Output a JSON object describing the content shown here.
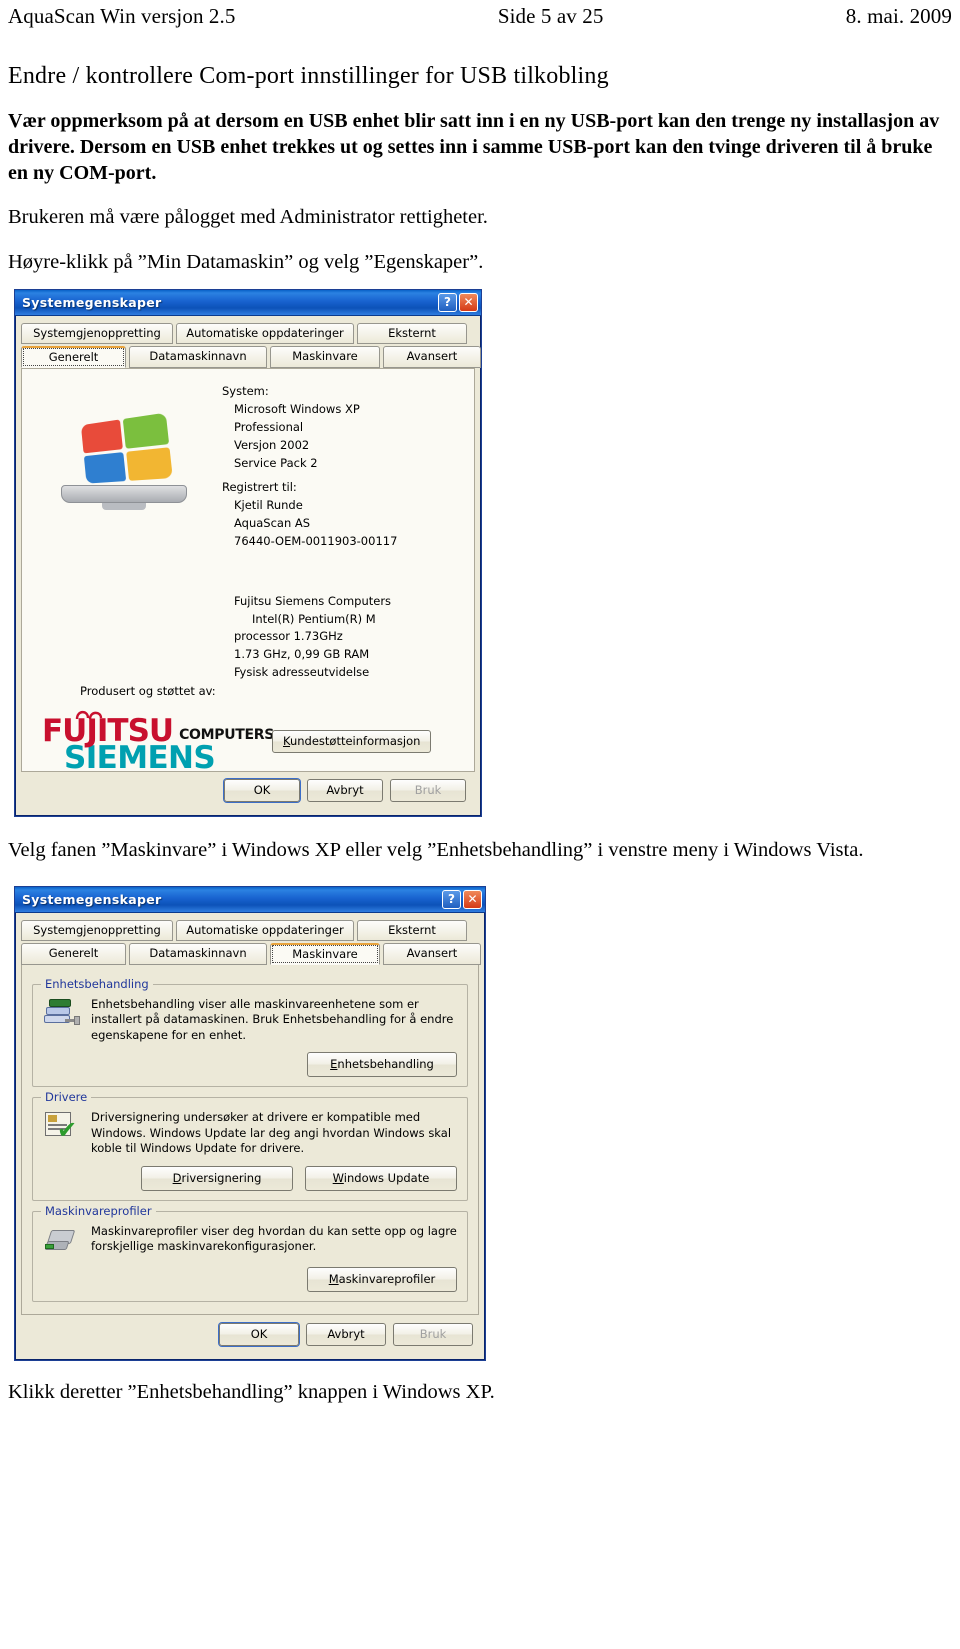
{
  "header": {
    "left": "AquaScan Win versjon 2.5",
    "center": "Side 5 av 25",
    "right": "8. mai. 2009"
  },
  "document": {
    "title": "Endre / kontrollere Com-port innstillinger for USB tilkobling",
    "warning": "Vær oppmerksom på at dersom en USB enhet blir satt inn i en ny USB-port kan den trenge ny installasjon av drivere. Dersom en USB enhet trekkes ut og settes inn i samme USB-port kan den tvinge driveren til å bruke en ny COM-port.",
    "admin_note": "Brukeren må være pålogget med Administrator rettigheter.",
    "step_rightclick": "Høyre-klikk på ”Min Datamaskin” og velg ”Egenskaper”.",
    "step_selecttab": "Velg fanen ”Maskinvare” i Windows XP eller velg ”Enhetsbehandling” i venstre meny i Windows Vista.",
    "step_clickbutton": "Klikk deretter ”Enhetsbehandling” knappen i Windows XP."
  },
  "dialog_general": {
    "title": "Systemegenskaper",
    "help_glyph": "?",
    "close_glyph": "✕",
    "tabs_row1": [
      "Systemgjenoppretting",
      "Automatiske oppdateringer",
      "Eksternt"
    ],
    "tabs_row2": [
      "Generelt",
      "Datamaskinnavn",
      "Maskinvare",
      "Avansert"
    ],
    "selected_tab": "Generelt",
    "system_label": "System:",
    "system_lines": [
      "Microsoft Windows XP",
      "Professional",
      "Versjon 2002",
      "Service Pack 2"
    ],
    "registered_label": "Registrert til:",
    "registered_lines": [
      "Kjetil Runde",
      "AquaScan AS",
      "76440-OEM-0011903-00117"
    ],
    "manufacturer_label": "Produsert og støttet av:",
    "manufacturer_lines": [
      "Fujitsu Siemens Computers",
      "Intel(R) Pentium(R) M",
      "processor 1.73GHz",
      "1.73 GHz, 0,99 GB RAM",
      "Fysisk adresseutvidelse"
    ],
    "logo": {
      "fujitsu": "FUJITSU",
      "computers": "COMPUTERS",
      "siemens": "SIEMENS",
      "fujitsu_color": "#c8102e",
      "siemens_color": "#00a0b0"
    },
    "support_button": "Kundestøtteinformasjon",
    "footer_buttons": [
      "OK",
      "Avbryt",
      "Bruk"
    ]
  },
  "dialog_hardware": {
    "title": "Systemegenskaper",
    "help_glyph": "?",
    "close_glyph": "✕",
    "tabs_row1": [
      "Systemgjenoppretting",
      "Automatiske oppdateringer",
      "Eksternt"
    ],
    "tabs_row2": [
      "Generelt",
      "Datamaskinnavn",
      "Maskinvare",
      "Avansert"
    ],
    "selected_tab": "Maskinvare",
    "groups": [
      {
        "title": "Enhetsbehandling",
        "text": "Enhetsbehandling viser alle maskinvareenhetene som er installert på datamaskinen. Bruk Enhetsbehandling for å endre egenskapene for en enhet.",
        "buttons": [
          "Enhetsbehandling"
        ]
      },
      {
        "title": "Drivere",
        "text": "Driversignering undersøker at drivere er kompatible med Windows. Windows Update lar deg angi hvordan Windows skal koble til Windows Update for drivere.",
        "buttons": [
          "Driversignering",
          "Windows Update"
        ]
      },
      {
        "title": "Maskinvareprofiler",
        "text": "Maskinvareprofiler viser deg hvordan du kan sette opp og lagre forskjellige maskinvarekonfigurasjoner.",
        "buttons": [
          "Maskinvareprofiler"
        ]
      }
    ],
    "footer_buttons": [
      "OK",
      "Avbryt",
      "Bruk"
    ]
  },
  "colors": {
    "titlebar_blue": "#1862cf",
    "dialog_face": "#ece9d8",
    "group_label": "#21379b",
    "selected_tab_accent": "#e8a33d"
  }
}
